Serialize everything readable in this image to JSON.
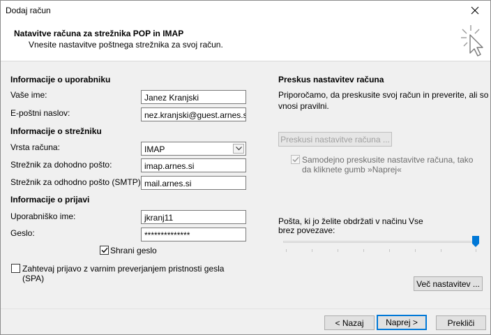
{
  "window": {
    "title": "Dodaj račun"
  },
  "header": {
    "title": "Natavitve računa za strežnika POP in IMAP",
    "subtitle": "Vnesite nastavitve poštnega strežnika za svoj račun."
  },
  "user_info": {
    "section": "Informacije o uporabniku",
    "name_label": "Vaše ime:",
    "name_value": "Janez Kranjski",
    "email_label": "E-poštni naslov:",
    "email_value": "nez.kranjski@guest.arnes.si"
  },
  "server_info": {
    "section": "Informacije o strežniku",
    "account_type_label": "Vrsta računa:",
    "account_type_value": "IMAP",
    "incoming_label": "Strežnik za dohodno pošto:",
    "incoming_value": "imap.arnes.si",
    "outgoing_label": "Strežnik za odhodno pošto (SMTP):",
    "outgoing_value": "mail.arnes.si"
  },
  "login_info": {
    "section": "Informacije o prijavi",
    "username_label": "Uporabniško ime:",
    "username_value": "jkranj11",
    "password_label": "Geslo:",
    "password_value": "**************",
    "remember_label": "Shrani geslo",
    "remember_checked": true,
    "spa_label_1": "Zahtevaj prijavo z varnim preverjanjem pristnosti gesla",
    "spa_label_2": "(SPA)",
    "spa_checked": false
  },
  "test_settings": {
    "section": "Preskus nastavitev računa",
    "description_1": "Priporočamo, da preskusite svoj račun in preverite, ali so",
    "description_2": "vnosi pravilni.",
    "test_button": "Preskusi nastavitve računa ...",
    "auto_test_label_1": "Samodejno preskusite nastavitve računa, tako",
    "auto_test_label_2": "da kliknete gumb »Naprej«",
    "auto_test_checked": true
  },
  "offline": {
    "label_1": "Pošta, ki jo želite obdržati v načinu",
    "value": "Vse",
    "label_2": "brez povezave:",
    "slider_level": 1.0
  },
  "buttons": {
    "more_settings": "Več nastavitev ...",
    "back": "< Nazaj",
    "next": "Naprej >",
    "cancel": "Prekliči"
  },
  "colors": {
    "accent": "#0078d7",
    "background": "#f0f0f0"
  },
  "icons": {
    "close": "close-icon",
    "header": "cursor-sparkle-icon",
    "checkmark": "checkmark-icon",
    "dropdown": "chevron-down-icon"
  }
}
